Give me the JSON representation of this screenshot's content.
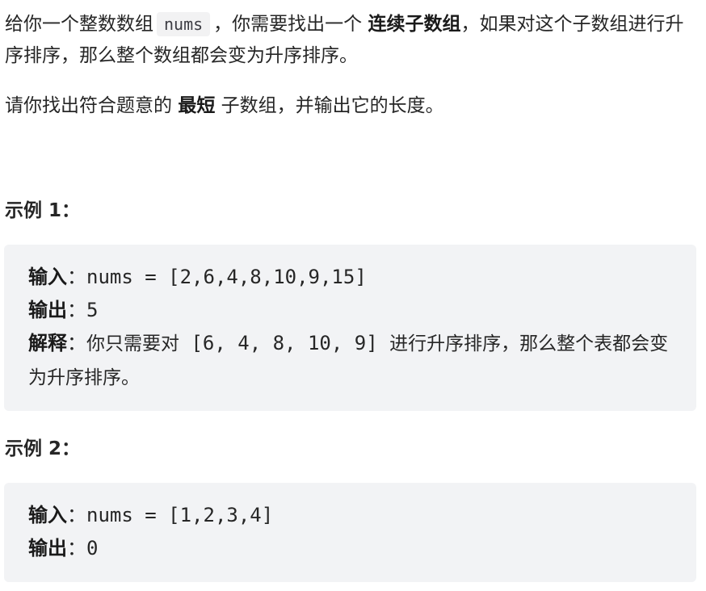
{
  "intro": {
    "part1": "给你一个整数数组",
    "code": "nums",
    "part2": "，你需要找出一个",
    "bold1": "连续子数组",
    "part3": "，如果对这个子数组进行升序排序，那么整个数组都会变为升序排序。"
  },
  "task": {
    "part1": "请你找出符合题意的",
    "bold": "最短",
    "part2": "子数组，并输出它的长度。"
  },
  "examples": [
    {
      "title": "示例 1：",
      "input_label": "输入",
      "input_value": "nums = [2,6,4,8,10,9,15]",
      "output_label": "输出",
      "output_value": "5",
      "explain_label": "解释",
      "explain_pre": "你只需要对",
      "explain_code": " [6, 4, 8, 10, 9] ",
      "explain_post": "进行升序排序，那么整个表都会变为升序排序。"
    },
    {
      "title": "示例 2：",
      "input_label": "输入",
      "input_value": "nums = [1,2,3,4]",
      "output_label": "输出",
      "output_value": "0"
    }
  ],
  "colon": "："
}
